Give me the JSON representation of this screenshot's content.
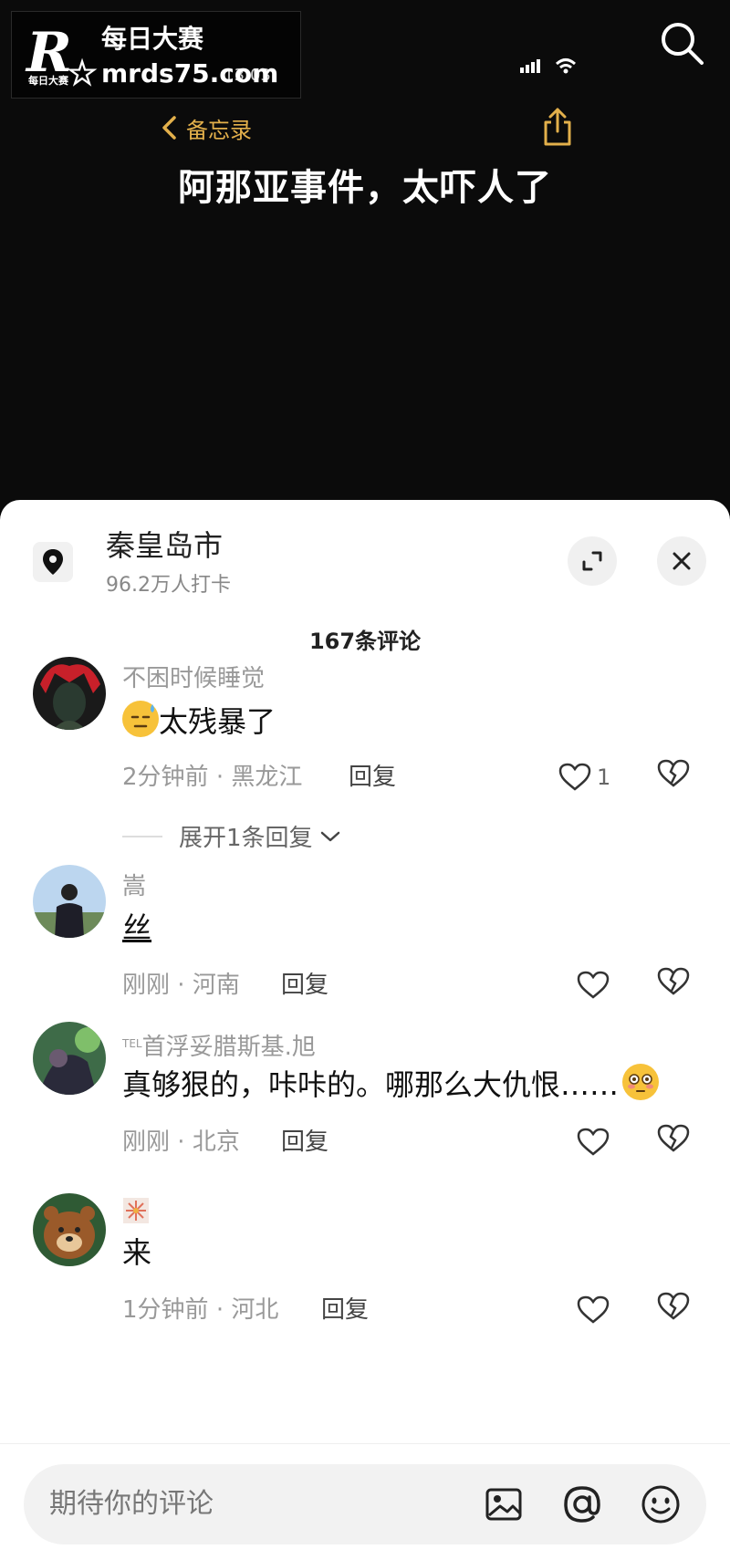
{
  "watermark": {
    "logo_letter": "R",
    "logo_small": "每日大赛",
    "title": "每日大赛",
    "url": "mrds75.com",
    "time": "13:03"
  },
  "notes": {
    "back_label": "备忘录"
  },
  "video": {
    "title": "阿那亚事件，太吓人了"
  },
  "location": {
    "name": "秦皇岛市",
    "checkins": "96.2万人打卡"
  },
  "comment_count": "167条评论",
  "comments": [
    {
      "user": "不困时候睡觉",
      "text": "太残暴了",
      "time": "2分钟前",
      "region": "黑龙江",
      "reply_label": "回复",
      "likes": "1",
      "expand_replies": "展开1条回复",
      "emoji": "cold-sweat-emoji"
    },
    {
      "user": "嵩",
      "text": "丝",
      "time": "刚刚",
      "region": "河南",
      "reply_label": "回复",
      "likes": ""
    },
    {
      "user": "首浮妥腊斯基.旭",
      "user_prefix": "TEL",
      "text": "真够狠的，咔咔的。哪那么大仇恨……",
      "time": "刚刚",
      "region": "北京",
      "reply_label": "回复",
      "likes": "",
      "emoji": "flushed-emoji"
    },
    {
      "user": "",
      "text": "来",
      "time": "1分钟前",
      "region": "河北",
      "reply_label": "回复",
      "likes": ""
    }
  ],
  "meta_separator": "·",
  "input": {
    "placeholder": "期待你的评论"
  },
  "colors": {
    "accent_gold": "#e3b04b",
    "sheet_bg": "#ffffff",
    "video_bg": "#0b0b0b"
  }
}
